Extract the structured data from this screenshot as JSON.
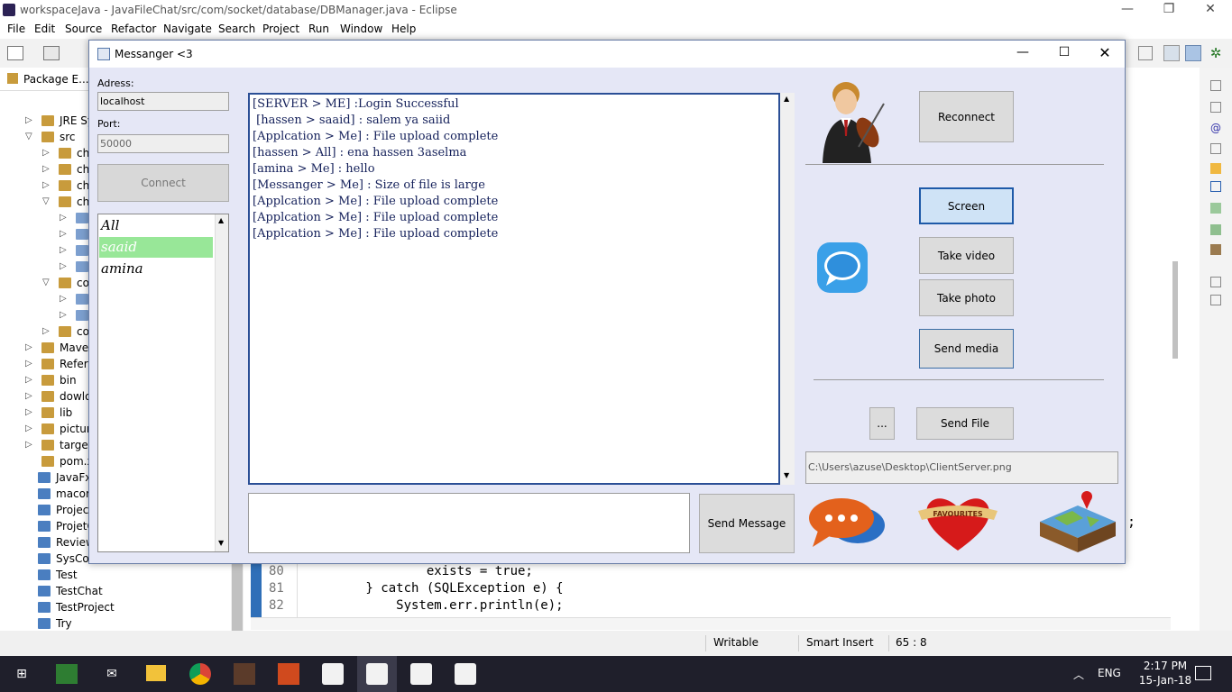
{
  "eclipse": {
    "title": "workspaceJava - JavaFileChat/src/com/socket/database/DBManager.java - Eclipse",
    "menu": [
      "File",
      "Edit",
      "Source",
      "Refactor",
      "Navigate",
      "Search",
      "Project",
      "Run",
      "Window",
      "Help"
    ],
    "package_explorer_tab": "Package E...",
    "tree": [
      {
        "label": "JRE Sy",
        "indent": 1,
        "arrow": "▷"
      },
      {
        "label": "src",
        "indent": 1,
        "arrow": "▽"
      },
      {
        "label": "ch",
        "indent": 2,
        "arrow": "▷"
      },
      {
        "label": "ch",
        "indent": 2,
        "arrow": "▷"
      },
      {
        "label": "ch",
        "indent": 2,
        "arrow": "▷"
      },
      {
        "label": "ch",
        "indent": 2,
        "arrow": "▽"
      },
      {
        "label": "",
        "indent": 3,
        "arrow": "▷"
      },
      {
        "label": "",
        "indent": 3,
        "arrow": "▷"
      },
      {
        "label": "",
        "indent": 3,
        "arrow": "▷"
      },
      {
        "label": "",
        "indent": 3,
        "arrow": "▷"
      },
      {
        "label": "co",
        "indent": 2,
        "arrow": "▽"
      },
      {
        "label": "",
        "indent": 3,
        "arrow": "▷"
      },
      {
        "label": "",
        "indent": 3,
        "arrow": "▷"
      },
      {
        "label": "co",
        "indent": 2,
        "arrow": "▷"
      },
      {
        "label": "Maven",
        "indent": 1,
        "arrow": "▷"
      },
      {
        "label": "Refere",
        "indent": 1,
        "arrow": "▷"
      },
      {
        "label": "bin",
        "indent": 1,
        "arrow": "▷"
      },
      {
        "label": "dowlo",
        "indent": 1,
        "arrow": "▷"
      },
      {
        "label": "lib",
        "indent": 1,
        "arrow": "▷"
      },
      {
        "label": "pictur",
        "indent": 1,
        "arrow": "▷"
      },
      {
        "label": "target",
        "indent": 1,
        "arrow": "▷"
      },
      {
        "label": "pom.x",
        "indent": 1,
        "arrow": ""
      },
      {
        "label": "JavaFx",
        "indent": 0,
        "arrow": ""
      },
      {
        "label": "macorrec",
        "indent": 0,
        "arrow": ""
      },
      {
        "label": "ProjectJav",
        "indent": 0,
        "arrow": ""
      },
      {
        "label": "ProjetCha",
        "indent": 0,
        "arrow": ""
      },
      {
        "label": "ReviewAll",
        "indent": 0,
        "arrow": ""
      },
      {
        "label": "SysComm",
        "indent": 0,
        "arrow": ""
      },
      {
        "label": "Test",
        "indent": 0,
        "arrow": ""
      },
      {
        "label": "TestChat",
        "indent": 0,
        "arrow": ""
      },
      {
        "label": "TestProject",
        "indent": 0,
        "arrow": ""
      },
      {
        "label": "Try",
        "indent": 0,
        "arrow": ""
      }
    ],
    "code": [
      {
        "num": "80",
        "text": "                exists = true;"
      },
      {
        "num": "81",
        "text": "        } catch (SQLException e) {"
      },
      {
        "num": "82",
        "text": "            System.err.println(e);"
      }
    ],
    "code_edge_text": ";",
    "status": {
      "writable": "Writable",
      "insert": "Smart Insert",
      "position": "65 : 8"
    }
  },
  "taskbar": {
    "lang": "ENG",
    "time": "2:17 PM",
    "date": "15-Jan-18"
  },
  "messenger": {
    "title": "Messanger <3",
    "address_label": "Adress:",
    "address_value": "localhost",
    "port_label": "Port:",
    "port_value": "50000",
    "connect_label": "Connect",
    "users": [
      {
        "name": "All",
        "selected": false
      },
      {
        "name": "saaid",
        "selected": true
      },
      {
        "name": "amina",
        "selected": false
      }
    ],
    "chat": [
      "[SERVER > ME] :Login Successful",
      " [hassen > saaid] : salem ya saiid",
      "[Applcation > Me] : File upload complete",
      "[hassen > All] : ena hassen 3aselma",
      "[amina > Me] : hello",
      "[Messanger > Me] : Size of file is large",
      "[Applcation > Me] : File upload complete",
      "[Applcation > Me] : File upload complete",
      "[Applcation > Me] : File upload complete"
    ],
    "message_input": "",
    "send_message_label": "Send Message",
    "reconnect_label": "Reconnect",
    "screen_label": "Screen",
    "take_video_label": "Take video",
    "take_photo_label": "Take photo",
    "send_media_label": "Send media",
    "browse_label": "...",
    "send_file_label": "Send File",
    "file_path": "C:\\Users\\azuse\\Desktop\\ClientServer.png",
    "favourites_label": "FAVOURITES",
    "selected_user_color": "#98e798",
    "accent_color": "#1e5aa8"
  }
}
